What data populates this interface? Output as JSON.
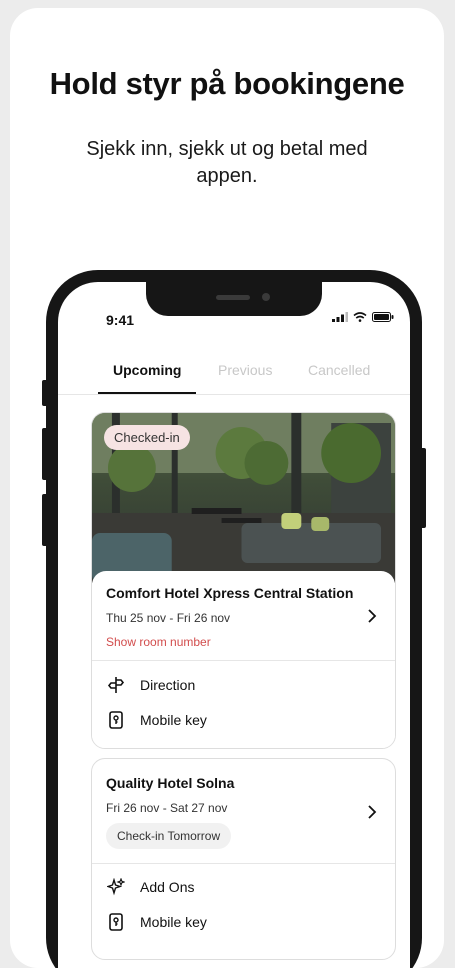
{
  "headline": "Hold styr på bookingene",
  "subline": "Sjekk inn, sjekk ut og betal med appen.",
  "status_bar": {
    "time": "9:41"
  },
  "tabs": [
    {
      "label": "Upcoming",
      "active": true
    },
    {
      "label": "Previous",
      "active": false
    },
    {
      "label": "Cancelled",
      "active": false
    }
  ],
  "bookings": [
    {
      "status_badge": "Checked-in",
      "hotel_name": "Comfort Hotel Xpress Central Station",
      "dates": "Thu 25 nov - Fri 26 nov",
      "room_link": "Show room number",
      "actions": [
        {
          "label": "Direction",
          "icon": "signpost-icon"
        },
        {
          "label": "Mobile key",
          "icon": "mobile-key-icon"
        }
      ]
    },
    {
      "hotel_name": "Quality Hotel Solna",
      "dates": "Fri 26 nov - Sat 27 nov",
      "checkin_badge": "Check-in Tomorrow",
      "actions": [
        {
          "label": "Add Ons",
          "icon": "sparkle-icon"
        },
        {
          "label": "Mobile key",
          "icon": "mobile-key-icon"
        }
      ]
    }
  ],
  "colors": {
    "accent_red": "#d24d4d",
    "badge_pink": "#f6e3e3",
    "phone_frame": "#161616"
  }
}
